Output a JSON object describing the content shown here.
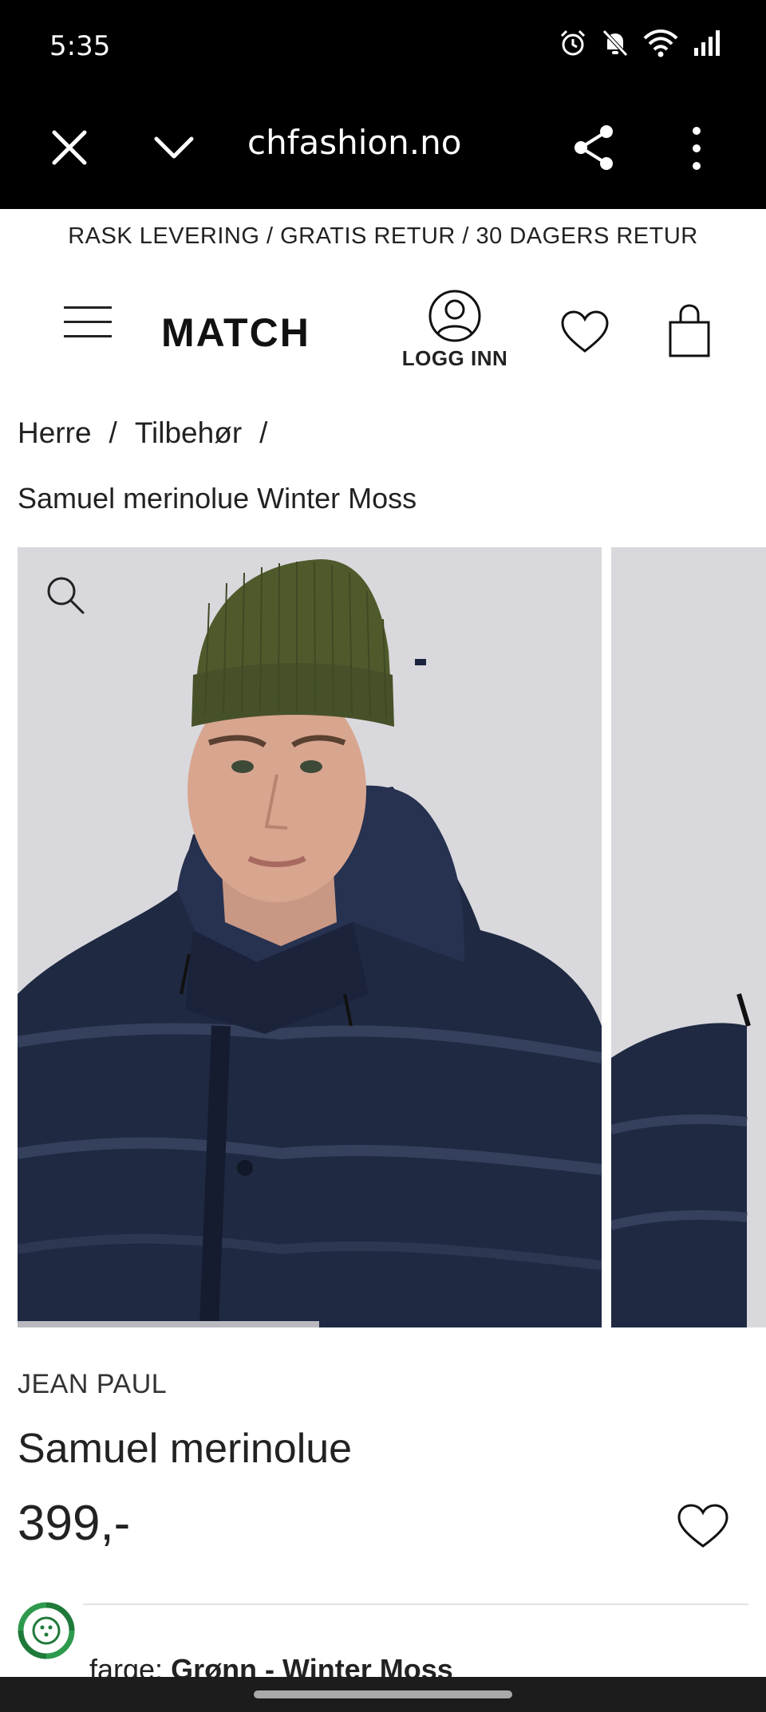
{
  "status": {
    "time": "5:35",
    "icons": [
      "alarm-icon",
      "mute-icon",
      "wifi-icon",
      "signal-icon"
    ]
  },
  "browser": {
    "url": "matchfashion.no",
    "url_visible": "chfashion.no",
    "icons": [
      "close-icon",
      "chevron-down-icon",
      "share-icon",
      "more-vert-icon"
    ]
  },
  "promo": {
    "text": "RASK LEVERING / GRATIS RETUR / 30 DAGERS RETUR"
  },
  "header": {
    "logo": "MATCH",
    "login_label": "LOGG INN",
    "icons": [
      "menu-icon",
      "user-icon",
      "heart-icon",
      "bag-icon"
    ]
  },
  "breadcrumb": {
    "items": [
      "Herre",
      "Tilbehør"
    ],
    "separator": "/",
    "current": "Samuel merinolue Winter Moss"
  },
  "gallery": {
    "zoom_icon": "search-icon",
    "active_slide": 1
  },
  "product": {
    "brand": "JEAN PAUL",
    "name": "Samuel merinolue",
    "price": "399,-",
    "color_label": "farge:",
    "color_value": "Grønn - Winter Moss"
  },
  "colors": {
    "statusbar_bg": "#000000",
    "hat": "#4f5a2c",
    "jacket": "#1e2840",
    "image_bg": "#d9d9dd",
    "eco_green": "#1f7a3a"
  }
}
